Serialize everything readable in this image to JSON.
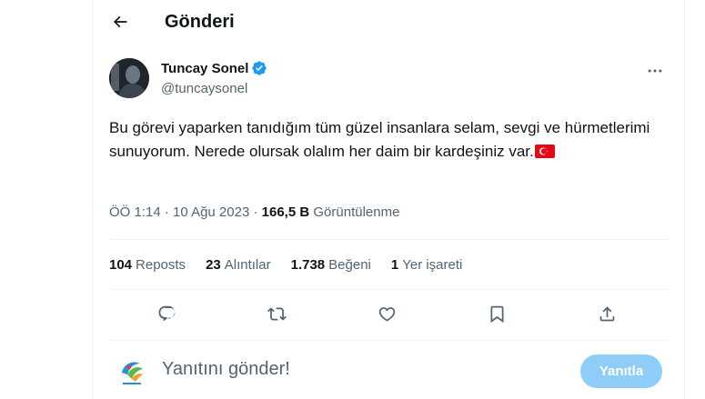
{
  "header": {
    "title": "Gönderi",
    "back_icon": "arrow-left-icon"
  },
  "author": {
    "display_name": "Tuncay Sonel",
    "handle": "@tuncaysonel",
    "verified": true,
    "verified_color": "#1d9bf0"
  },
  "tweet": {
    "text": "Bu görevi yaparken tanıdığım tüm güzel insanlara selam, sevgi ve hürmetlerimi sunuyorum. Nerede olursak olalım her daim bir kardeşiniz var.",
    "emoji": "turkish-flag"
  },
  "meta": {
    "time": "ÖÖ 1:14",
    "separator": "·",
    "date": "10 Ağu 2023",
    "views_count": "166,5 B",
    "views_label": "Görüntülenme"
  },
  "stats": [
    {
      "count": "104",
      "label": "Reposts"
    },
    {
      "count": "23",
      "label": "Alıntılar"
    },
    {
      "count": "1.738",
      "label": "Beğeni"
    },
    {
      "count": "1",
      "label": "Yer işareti"
    }
  ],
  "actions": [
    "reply-icon",
    "repost-icon",
    "like-icon",
    "bookmark-icon",
    "share-icon"
  ],
  "reply": {
    "placeholder": "Yanıtını gönder!",
    "button_label": "Yanıtla",
    "button_color": "#8ecdf8"
  }
}
